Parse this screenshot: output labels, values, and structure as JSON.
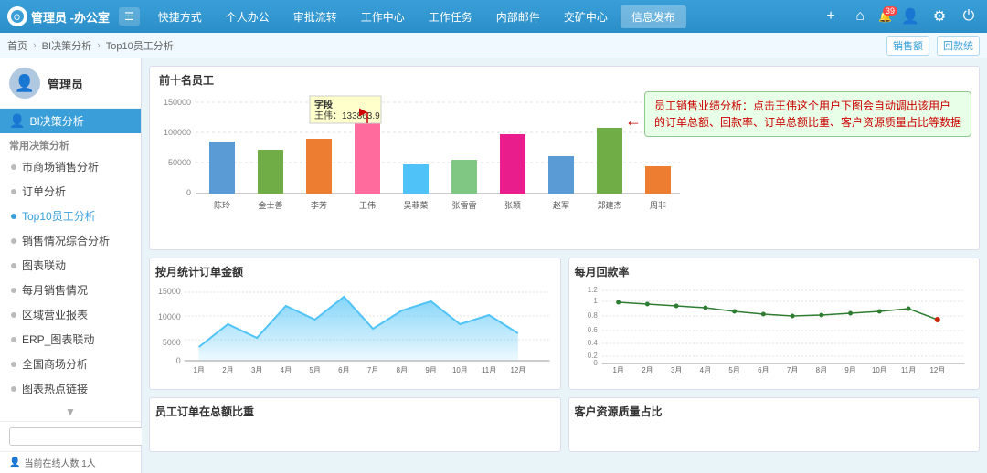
{
  "topbar": {
    "logo_text": "管理员 -办公室",
    "menu_icon": "☰",
    "nav_items": [
      "快捷方式",
      "个人办公",
      "审批流转",
      "工作中心",
      "工作任务",
      "内部邮件",
      "交矿中心",
      "信息发布"
    ],
    "active_nav": "信息发布",
    "right_icons": [
      "+",
      "🏠"
    ],
    "badge_count": "39",
    "notification_label": "销售额",
    "notification2_label": "回款统"
  },
  "secondbar": {
    "right_btns": [
      "销售额",
      "回款统"
    ]
  },
  "sidebar": {
    "username": "管理员",
    "section_title": "BI决策分析",
    "group_label": "常用决策分析",
    "items": [
      {
        "label": "市商场销售分析",
        "active": false
      },
      {
        "label": "订单分析",
        "active": false
      },
      {
        "label": "Top10员工分析",
        "active": true
      },
      {
        "label": "销售情况综合分析",
        "active": false
      },
      {
        "label": "图表联动",
        "active": false
      },
      {
        "label": "每月销售情况",
        "active": false
      },
      {
        "label": "区域营业报表",
        "active": false
      },
      {
        "label": "ERP_图表联动",
        "active": false
      },
      {
        "label": "全国商场分析",
        "active": false
      },
      {
        "label": "图表热点链接",
        "active": false
      }
    ],
    "search_placeholder": "",
    "online_text": "当前在线人数 1人"
  },
  "main": {
    "bar_chart": {
      "title": "前十名员工",
      "y_labels": [
        "150000",
        "100000",
        "50000",
        "0"
      ],
      "bars": [
        {
          "label": "陈玲",
          "value": 85000,
          "color": "#5b9bd5",
          "max": 150000
        },
        {
          "label": "金士善",
          "value": 72000,
          "color": "#70ad47",
          "max": 150000
        },
        {
          "label": "李芳",
          "value": 90000,
          "color": "#ed7d31",
          "max": 150000
        },
        {
          "label": "王伟",
          "value": 133863.9,
          "color": "#ff6b9d",
          "max": 150000
        },
        {
          "label": "吴菲菜",
          "value": 48000,
          "color": "#4fc3f7",
          "max": 150000
        },
        {
          "label": "张雷雷",
          "value": 55000,
          "color": "#81c784",
          "max": 150000
        },
        {
          "label": "张颖",
          "value": 97000,
          "color": "#e91e8c",
          "max": 150000
        },
        {
          "label": "赵军",
          "value": 62000,
          "color": "#5b9bd5",
          "max": 150000
        },
        {
          "label": "郑建杰",
          "value": 108000,
          "color": "#70ad47",
          "max": 150000
        },
        {
          "label": "周非",
          "value": 45000,
          "color": "#ed7d31",
          "max": 150000
        }
      ],
      "tooltip": {
        "title": "字段",
        "line": "王伟：133863.9"
      },
      "annotation": "员工销售业绩分析：点击王伟这个用户下图会自动调出该用户\n的订单总额、回款率、订单总额比重、客户资源质量占比等数据"
    },
    "area_chart": {
      "title": "按月统计订单金额",
      "y_labels": [
        "15000",
        "10000",
        "5000",
        "0"
      ],
      "x_labels": [
        "1月",
        "2月",
        "3月",
        "4月",
        "5月",
        "6月",
        "7月",
        "8月",
        "9月",
        "10月",
        "11月",
        "12月"
      ],
      "values": [
        3000,
        8000,
        5000,
        12000,
        9000,
        14000,
        7000,
        11000,
        13000,
        8000,
        10000,
        6000
      ]
    },
    "line_chart": {
      "title": "每月回款率",
      "y_labels": [
        "1.2",
        "1",
        "0.8",
        "0.6",
        "0.4",
        "0.2",
        "0"
      ],
      "x_labels": [
        "1月",
        "2月",
        "3月",
        "4月",
        "5月",
        "6月",
        "7月",
        "8月",
        "9月",
        "10月",
        "11月",
        "12月"
      ],
      "values": [
        1.0,
        0.98,
        0.95,
        0.92,
        0.88,
        0.85,
        0.82,
        0.8,
        0.83,
        0.86,
        0.9,
        0.72
      ]
    },
    "pie_charts": [
      {
        "title": "员工订单在总额比重"
      },
      {
        "title": "客户资源质量占比"
      }
    ]
  }
}
